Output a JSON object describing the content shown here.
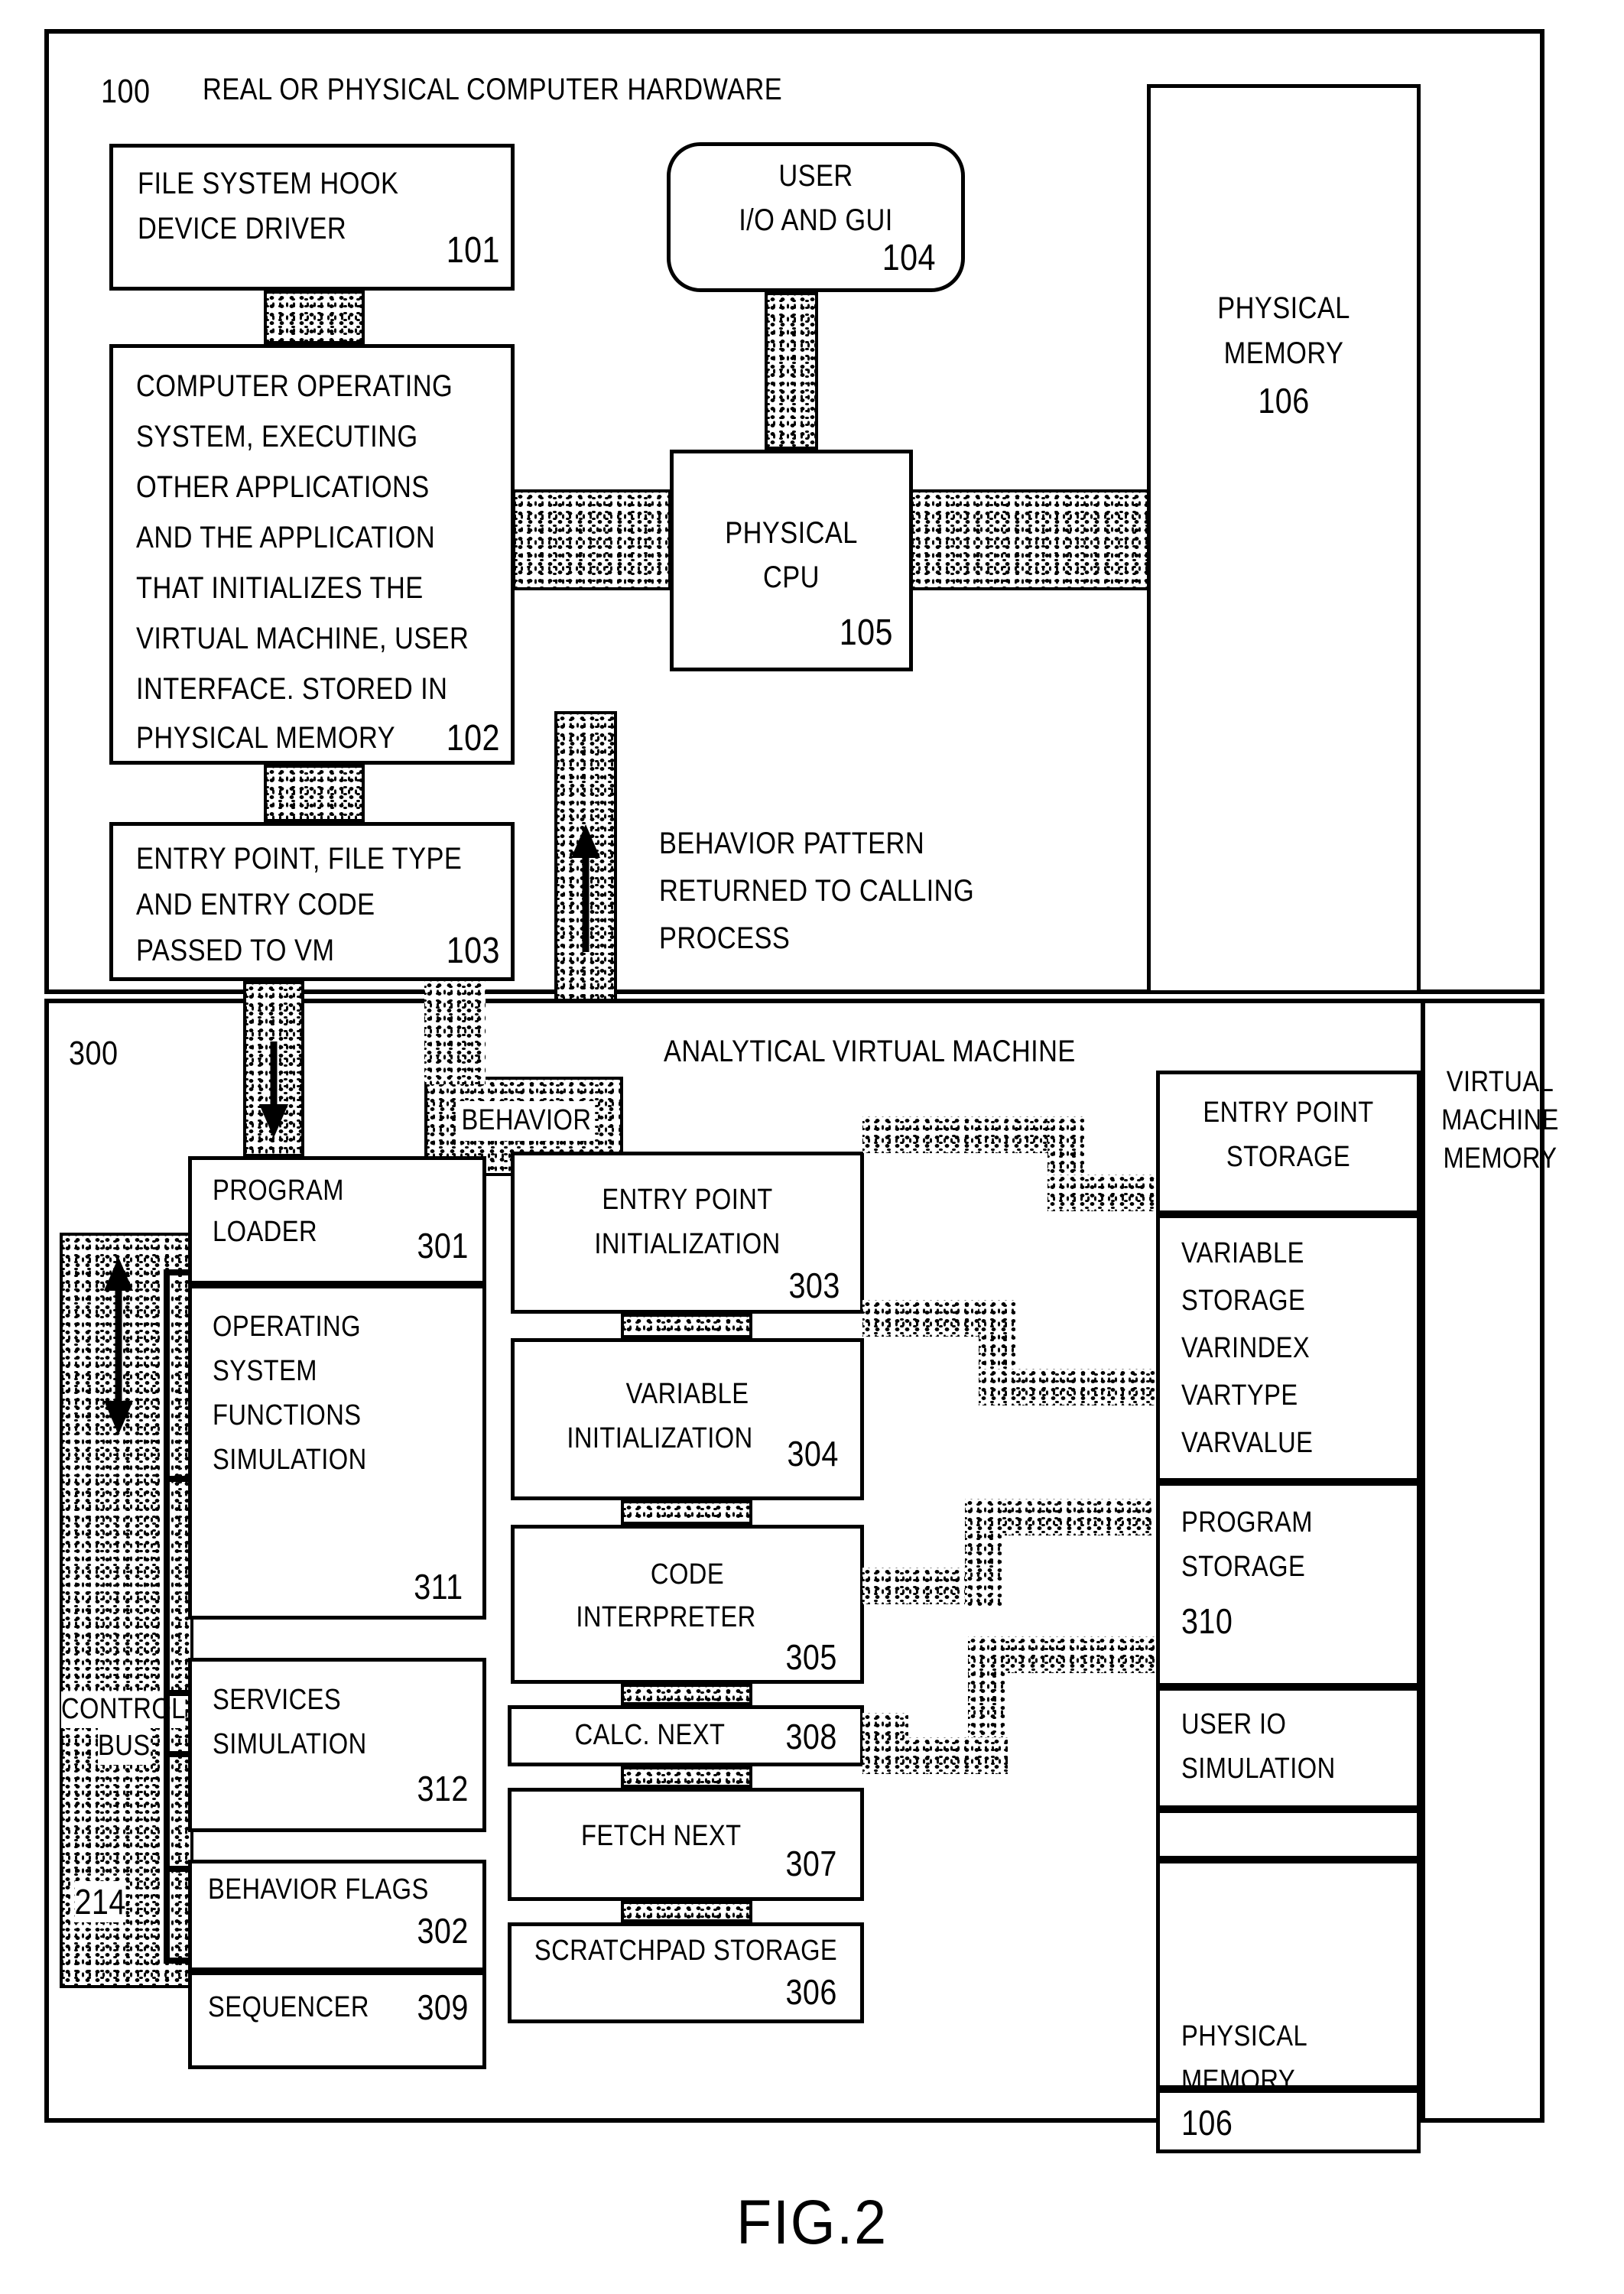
{
  "figure": {
    "caption": "FIG.2"
  },
  "upper_section": {
    "ref": "100",
    "title": "REAL OR PHYSICAL COMPUTER HARDWARE",
    "blocks": {
      "file_system_hook": {
        "line1": "FILE SYSTEM HOOK",
        "line2": "DEVICE DRIVER",
        "ref": "101"
      },
      "operating_system": {
        "line1": "COMPUTER OPERATING",
        "line2": "SYSTEM, EXECUTING",
        "line3": "OTHER APPLICATIONS",
        "line4": "AND THE APPLICATION",
        "line5": "THAT INITIALIZES THE",
        "line6": "VIRTUAL MACHINE, USER",
        "line7": "INTERFACE. STORED IN",
        "line8": "PHYSICAL MEMORY",
        "ref": "102"
      },
      "entry_point_passed": {
        "line1": "ENTRY POINT, FILE TYPE",
        "line2": "AND ENTRY CODE",
        "line3": "PASSED TO VM",
        "ref": "103"
      },
      "user_io_gui": {
        "line1": "USER",
        "line2": "I/O AND GUI",
        "ref": "104"
      },
      "physical_cpu": {
        "line1": "PHYSICAL",
        "line2": "CPU",
        "ref": "105"
      },
      "physical_memory": {
        "line1": "PHYSICAL",
        "line2": "MEMORY",
        "ref": "106"
      }
    },
    "annotations": {
      "behavior_pattern": {
        "line1": "BEHAVIOR PATTERN",
        "line2": "RETURNED TO CALLING",
        "line3": "PROCESS"
      }
    }
  },
  "lower_section": {
    "ref": "300",
    "title": "ANALYTICAL VIRTUAL MACHINE",
    "behavior_connector_label": "BEHAVIOR",
    "control_bus": {
      "line1": "CONTROL",
      "line2": "BUS",
      "ref": "214"
    },
    "blocks": {
      "program_loader": {
        "line1": "PROGRAM",
        "line2": "LOADER",
        "ref": "301"
      },
      "os_functions_sim": {
        "line1": "OPERATING",
        "line2": "SYSTEM",
        "line3": "FUNCTIONS",
        "line4": "SIMULATION",
        "ref": "311"
      },
      "services_sim": {
        "line1": "SERVICES",
        "line2": "SIMULATION",
        "ref": "312"
      },
      "behavior_flags": {
        "line1": "BEHAVIOR FLAGS",
        "ref": "302"
      },
      "sequencer": {
        "line1": "SEQUENCER",
        "ref": "309"
      },
      "entry_point_init": {
        "line1": "ENTRY POINT",
        "line2": "INITIALIZATION",
        "ref": "303"
      },
      "variable_init": {
        "line1": "VARIABLE",
        "line2": "INITIALIZATION",
        "ref": "304"
      },
      "code_interpreter": {
        "line1": "CODE",
        "line2": "INTERPRETER",
        "ref": "305"
      },
      "calc_next": {
        "line1": "CALC. NEXT",
        "ref": "308"
      },
      "fetch_next": {
        "line1": "FETCH NEXT",
        "ref": "307"
      },
      "scratchpad_storage": {
        "line1": "SCRATCHPAD STORAGE",
        "ref": "306"
      }
    },
    "vm_memory": {
      "title": {
        "line1": "VIRTUAL",
        "line2": "MACHINE",
        "line3": "MEMORY"
      },
      "cells": {
        "entry_point_storage": {
          "line1": "ENTRY POINT",
          "line2": "STORAGE"
        },
        "variable_storage": {
          "line1": "VARIABLE",
          "line2": "STORAGE",
          "line3": "VARINDEX",
          "line4": "VARTYPE",
          "line5": "VARVALUE"
        },
        "program_storage": {
          "line1": "PROGRAM",
          "line2": "STORAGE",
          "ref": "310"
        },
        "user_io_sim": {
          "line1": "USER IO",
          "line2": "SIMULATION"
        },
        "physical_memory": {
          "line1": "PHYSICAL",
          "line2": "MEMORY",
          "ref": "106"
        }
      }
    }
  }
}
